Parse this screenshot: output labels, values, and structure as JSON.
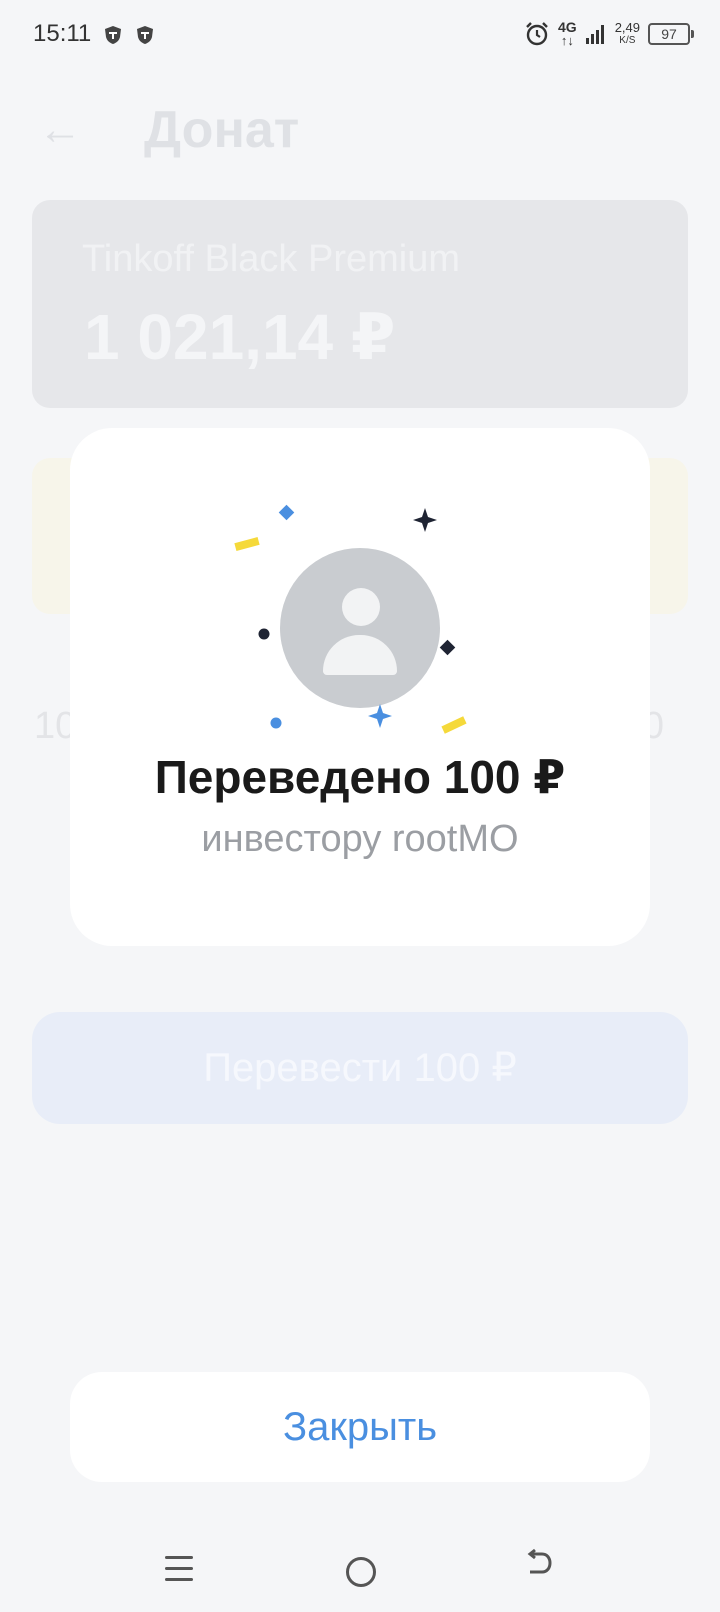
{
  "status_bar": {
    "time": "15:11",
    "network_generation": "4G",
    "network_arrows": "↑↓",
    "speed_value": "2,49",
    "speed_unit": "K/S",
    "battery": "97",
    "icons": [
      "shield-app-icon",
      "shield-app-icon",
      "alarm-icon",
      "signal-icon",
      "battery-icon"
    ]
  },
  "background_page": {
    "title": "Донат",
    "card_name": "Tinkoff Black Premium",
    "card_balance": "1 021,14 ₽",
    "amount_left": "10",
    "amount_right": "0",
    "transfer_button_label": "Перевести 100 ₽"
  },
  "dialog": {
    "title": "Переведено 100 ₽",
    "subtitle": "инвестору rootMO",
    "avatar_icon": "user-placeholder-icon"
  },
  "close_button_label": "Закрыть",
  "nav_bar": {
    "icons": [
      "menu-icon",
      "home-icon",
      "back-icon"
    ]
  },
  "colors": {
    "accent": "#4a8fe0",
    "confetti_blue": "#4a8fe0",
    "confetti_dark": "#1f2433",
    "confetti_yellow": "#f5d93a"
  }
}
